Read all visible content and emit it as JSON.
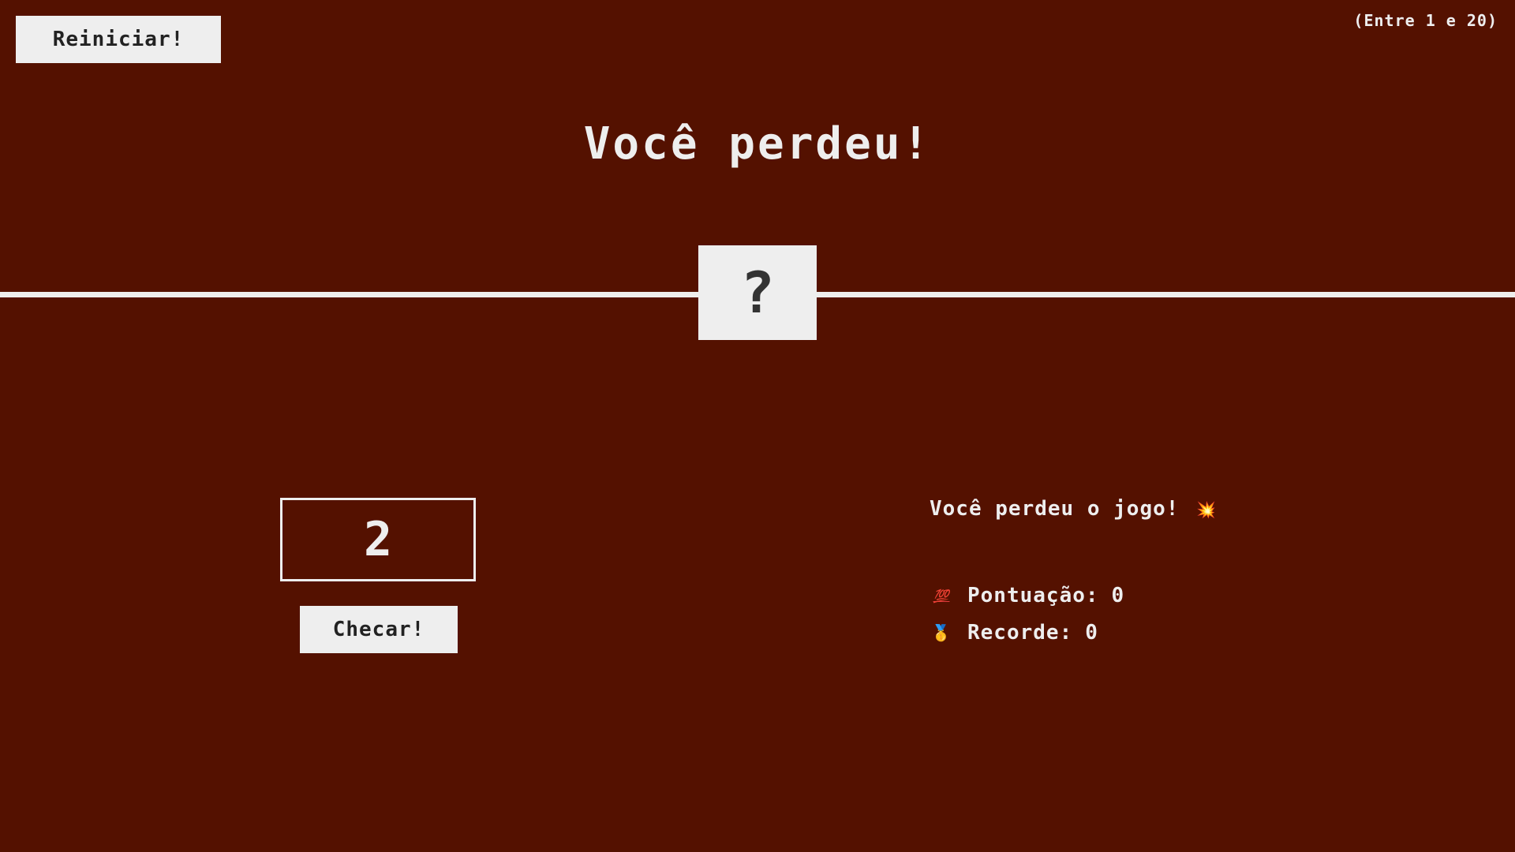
{
  "header": {
    "again_label": "Reiniciar!",
    "between_text": "(Entre 1 e 20)"
  },
  "title": "Você perdeu!",
  "secret_number": "?",
  "guess": {
    "value": "2"
  },
  "check_label": "Checar!",
  "message": "Você perdeu o jogo!",
  "stats": {
    "score_icon": "💯",
    "score_label": "Pontuação:",
    "score_value": "0",
    "highscore_icon": "🥇",
    "highscore_label": "Recorde:",
    "highscore_value": "0"
  },
  "icons": {
    "message_icon": "💥"
  },
  "colors": {
    "background": "#541100",
    "foreground": "#eeeeee",
    "dark_text": "#222222"
  }
}
